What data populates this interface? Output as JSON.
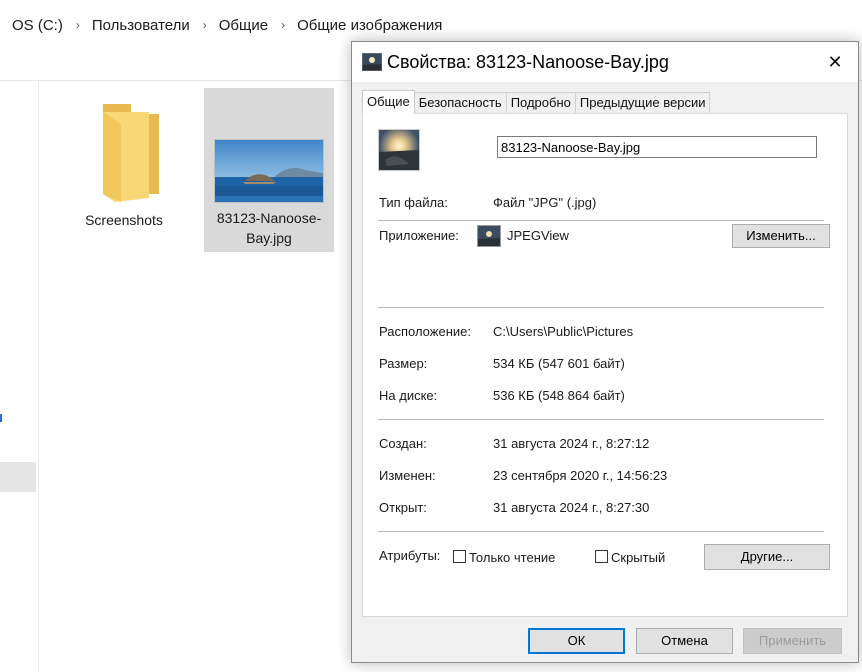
{
  "explorer": {
    "breadcrumb": [
      "OS (C:)",
      "Пользователи",
      "Общие",
      "Общие изображения"
    ],
    "items": [
      {
        "name": "Screenshots",
        "type": "folder"
      },
      {
        "name": "83123-Nanoose-Bay.jpg",
        "label_line1": "83123-Nanoose-",
        "label_line2": "Bay.jpg",
        "type": "image",
        "selected": true
      }
    ]
  },
  "dialog": {
    "title": "Свойства: 83123-Nanoose-Bay.jpg",
    "close_glyph": "✕",
    "tabs": [
      {
        "label": "Общие",
        "active": true
      },
      {
        "label": "Безопасность"
      },
      {
        "label": "Подробно"
      },
      {
        "label": "Предыдущие версии"
      }
    ],
    "general": {
      "filename": "83123-Nanoose-Bay.jpg",
      "file_type_label": "Тип файла:",
      "file_type_value": "Файл \"JPG\" (.jpg)",
      "app_label": "Приложение:",
      "app_value": "JPEGView",
      "change_button": "Изменить...",
      "location_label": "Расположение:",
      "location_value": "C:\\Users\\Public\\Pictures",
      "size_label": "Размер:",
      "size_value": "534 КБ (547 601 байт)",
      "disk_label": "На диске:",
      "disk_value": "536 КБ (548 864 байт)",
      "created_label": "Создан:",
      "created_value": "31 августа 2024 г., 8:27:12",
      "modified_label": "Изменен:",
      "modified_value": "23 сентября 2020 г., 14:56:23",
      "accessed_label": "Открыт:",
      "accessed_value": "31 августа 2024 г., 8:27:30",
      "attributes_label": "Атрибуты:",
      "readonly_label": "Только чтение",
      "readonly_checked": false,
      "hidden_label": "Скрытый",
      "hidden_checked": false,
      "other_button": "Другие..."
    },
    "buttons": {
      "ok": "ОК",
      "cancel": "Отмена",
      "apply": "Применить"
    }
  },
  "colors": {
    "dialog_bg": "#f0f0f0",
    "default_button_border": "#0078d7",
    "selection_bg": "#d9d9d9",
    "folder_yellow": "#f8d775"
  }
}
